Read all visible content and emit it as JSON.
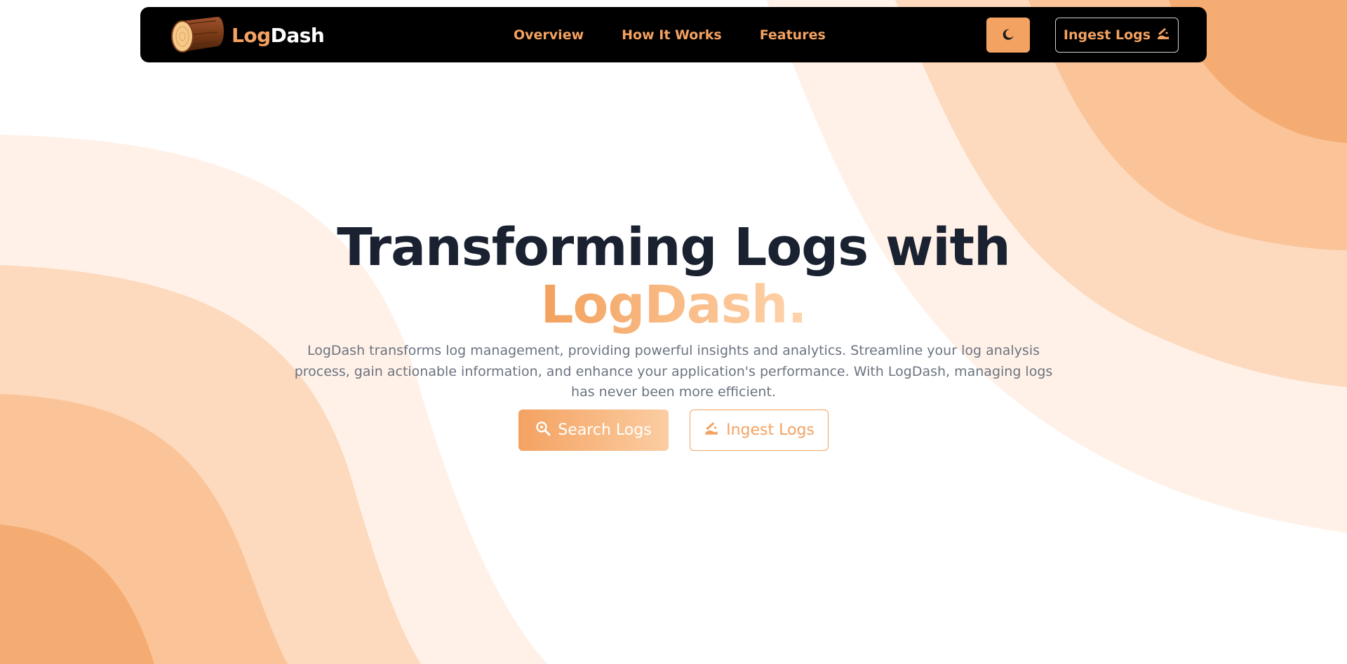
{
  "colors": {
    "accent": "#f4a261",
    "accent_light": "#ffd4ac",
    "nav_background": "#000000",
    "title": "#1a2130",
    "body_text": "#6b7380",
    "wave_1": "#fff1e7",
    "wave_2": "#fdd9bd",
    "wave_3": "#fbc498",
    "wave_4": "#f5ac72"
  },
  "nav": {
    "brand_log": "Log",
    "brand_dash": "Dash",
    "links": [
      "Overview",
      "How It Works",
      "Features"
    ],
    "theme_toggle_icon": "moon-icon",
    "ingest_label": "Ingest Logs",
    "ingest_icon": "log-sawing-icon"
  },
  "hero": {
    "title_line1": "Transforming Logs with",
    "title_line2": "LogDash.",
    "description": "LogDash transforms log management, providing powerful insights and analytics. Streamline your log analysis process, gain actionable information, and enhance your application's performance. With LogDash, managing logs has never been more efficient.",
    "search_button": "Search Logs",
    "search_icon": "magnifier-icon",
    "ingest_button": "Ingest Logs",
    "ingest_icon": "log-sawing-icon"
  }
}
